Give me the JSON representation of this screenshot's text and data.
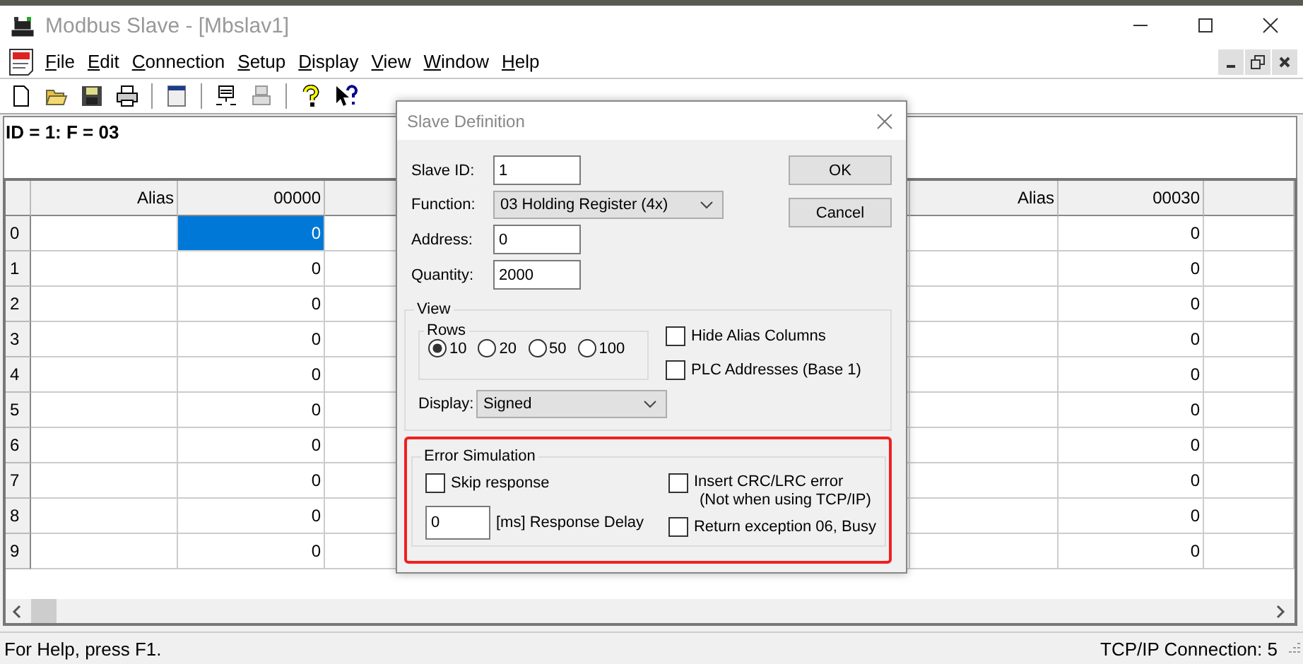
{
  "window": {
    "title": "Modbus Slave - [Mbslav1]"
  },
  "menu": [
    {
      "label": "File"
    },
    {
      "label": "Edit"
    },
    {
      "label": "Connection"
    },
    {
      "label": "Setup"
    },
    {
      "label": "Display"
    },
    {
      "label": "View"
    },
    {
      "label": "Window"
    },
    {
      "label": "Help"
    }
  ],
  "info_line": "ID = 1: F = 03",
  "grid": {
    "left_columns": [
      "Alias",
      "00000"
    ],
    "right_columns": [
      "Alias",
      "00030"
    ],
    "rows": [
      {
        "header": "0",
        "left_value": {
          "text": "0",
          "selected": true
        },
        "right_value": {
          "text": "0",
          "selected": false
        }
      },
      {
        "header": "1",
        "left_value": {
          "text": "0",
          "selected": false
        },
        "right_value": {
          "text": "0",
          "selected": false
        }
      },
      {
        "header": "2",
        "left_value": {
          "text": "0",
          "selected": false
        },
        "right_value": {
          "text": "0",
          "selected": false
        }
      },
      {
        "header": "3",
        "left_value": {
          "text": "0",
          "selected": false
        },
        "right_value": {
          "text": "0",
          "selected": false
        }
      },
      {
        "header": "4",
        "left_value": {
          "text": "0",
          "selected": false
        },
        "right_value": {
          "text": "0",
          "selected": false
        }
      },
      {
        "header": "5",
        "left_value": {
          "text": "0",
          "selected": false
        },
        "right_value": {
          "text": "0",
          "selected": false
        }
      },
      {
        "header": "6",
        "left_value": {
          "text": "0",
          "selected": false
        },
        "right_value": {
          "text": "0",
          "selected": false
        }
      },
      {
        "header": "7",
        "left_value": {
          "text": "0",
          "selected": false
        },
        "right_value": {
          "text": "0",
          "selected": false
        }
      },
      {
        "header": "8",
        "left_value": {
          "text": "0",
          "selected": false
        },
        "right_value": {
          "text": "0",
          "selected": false
        }
      },
      {
        "header": "9",
        "left_value": {
          "text": "0",
          "selected": false
        },
        "right_value": {
          "text": "0",
          "selected": false
        }
      }
    ]
  },
  "dialog": {
    "title": "Slave Definition",
    "fields": [
      {
        "kind": "input",
        "label": "Slave ID:",
        "value": "1"
      },
      {
        "kind": "select",
        "label": "Function:",
        "value": "03 Holding Register (4x)"
      },
      {
        "kind": "input",
        "label": "Address:",
        "value": "0"
      },
      {
        "kind": "input",
        "label": "Quantity:",
        "value": "2000"
      }
    ],
    "buttons": [
      "OK",
      "Cancel"
    ],
    "view": {
      "legend": "View",
      "rows_legend": "Rows",
      "rows_options": [
        {
          "label": "10",
          "selected": true
        },
        {
          "label": "20",
          "selected": false
        },
        {
          "label": "50",
          "selected": false
        },
        {
          "label": "100",
          "selected": false
        }
      ],
      "checkboxes": [
        {
          "label": "Hide Alias Columns",
          "checked": false
        },
        {
          "label": "PLC Addresses (Base 1)",
          "checked": false
        }
      ],
      "display": {
        "label": "Display:",
        "value": "Signed"
      }
    },
    "error_simulation": {
      "legend": "Error Simulation",
      "skip_response": {
        "label": "Skip response",
        "checked": false
      },
      "response_delay": {
        "value": "0",
        "label": "[ms] Response Delay"
      },
      "insert_crc": {
        "label": "Insert CRC/LRC error",
        "note": "(Not when using TCP/IP)",
        "checked": false
      },
      "return_exception": {
        "label": "Return exception 06, Busy",
        "checked": false
      }
    }
  },
  "status_bar": {
    "left": "For Help, press F1.",
    "right": "TCP/IP Connection: 5"
  }
}
